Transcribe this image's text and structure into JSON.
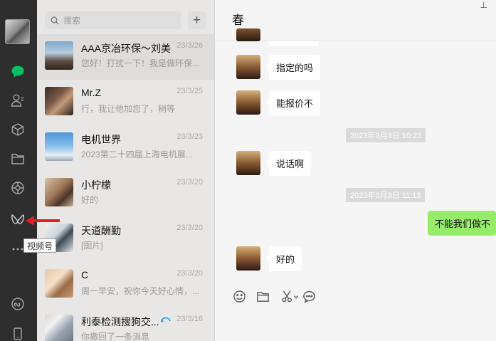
{
  "sidebar": {
    "tooltip": "视频号"
  },
  "search": {
    "placeholder": "搜索",
    "plus": "+"
  },
  "chats": [
    {
      "name": "AAA京冶环保～刘美",
      "date": "23/3/26",
      "preview": "您好！打扰一下！我是做环保..."
    },
    {
      "name": "Mr.Z",
      "date": "23/3/25",
      "preview": "行，我让他加您了，稍等"
    },
    {
      "name": "电机世界",
      "date": "23/3/23",
      "preview": "2023第二十四届上海电机展..."
    },
    {
      "name": "小柠檬",
      "date": "23/3/20",
      "preview": "好的"
    },
    {
      "name": "天道酬勤",
      "date": "23/3/20",
      "preview": "[图片]"
    },
    {
      "name": "C",
      "date": "23/3/20",
      "preview": "周一早安，祝你今天好心情，..."
    },
    {
      "name": "利泰检测搜狗交...",
      "date": "23/3/16",
      "preview": "你撤回了一条消息"
    }
  ],
  "conversation": {
    "title": "春",
    "pin": "⊥",
    "messages": [
      {
        "text": "指定的吗"
      },
      {
        "text": "能报价不"
      },
      {
        "timestamp": "2023年3月3日 10:23"
      },
      {
        "text": "说话啊"
      },
      {
        "timestamp": "2023年3月3日 11:13"
      },
      {
        "text": "不能我们做不"
      },
      {
        "text": "好的"
      }
    ]
  },
  "icons": {
    "emoji": "emoji-icon",
    "folder": "folder-icon",
    "scissors": "scissors-icon",
    "chat": "chat-bubble-icon"
  }
}
